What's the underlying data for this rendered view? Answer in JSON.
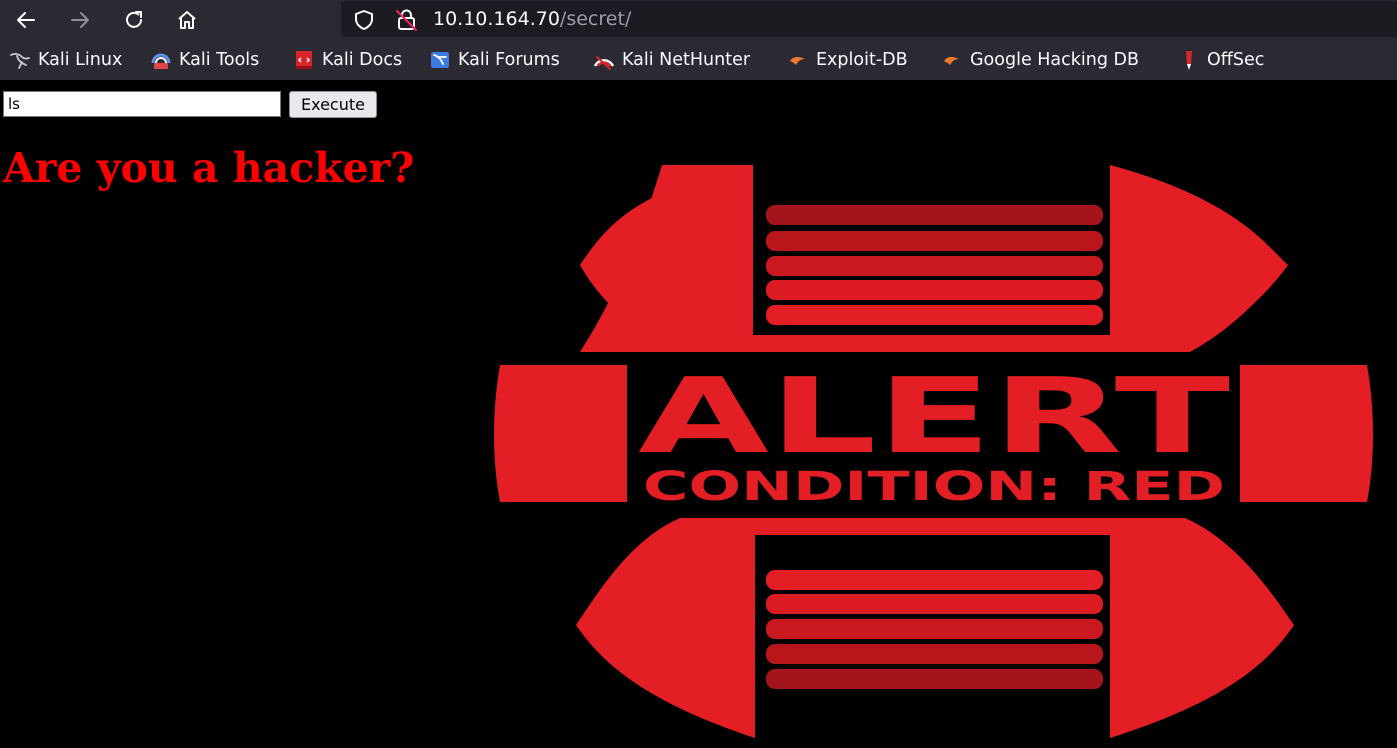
{
  "browser": {
    "url_host": "10.10.164.70",
    "url_path": "/secret/",
    "nav_icons": [
      "back-icon",
      "forward-icon",
      "reload-icon",
      "home-icon"
    ],
    "url_icons": [
      "tracking-protection-shield-icon",
      "insecure-lock-icon"
    ]
  },
  "bookmarks": [
    {
      "label": "Kali Linux",
      "icon": "kali-dragon-icon"
    },
    {
      "label": "Kali Tools",
      "icon": "kali-tools-icon"
    },
    {
      "label": "Kali Docs",
      "icon": "kali-docs-icon"
    },
    {
      "label": "Kali Forums",
      "icon": "kali-forums-icon"
    },
    {
      "label": "Kali NetHunter",
      "icon": "kali-nethunter-icon"
    },
    {
      "label": "Exploit-DB",
      "icon": "exploit-db-icon"
    },
    {
      "label": "Google Hacking DB",
      "icon": "ghdb-icon"
    },
    {
      "label": "OffSec",
      "icon": "offsec-icon"
    }
  ],
  "form": {
    "command_value": "ls",
    "execute_label": "Execute"
  },
  "page": {
    "headline": "Are you a hacker?",
    "headline_color": "#ff0000"
  },
  "alert_image": {
    "title": "ALERT",
    "subtitle": "CONDITION: RED",
    "color": "#e31e24"
  }
}
